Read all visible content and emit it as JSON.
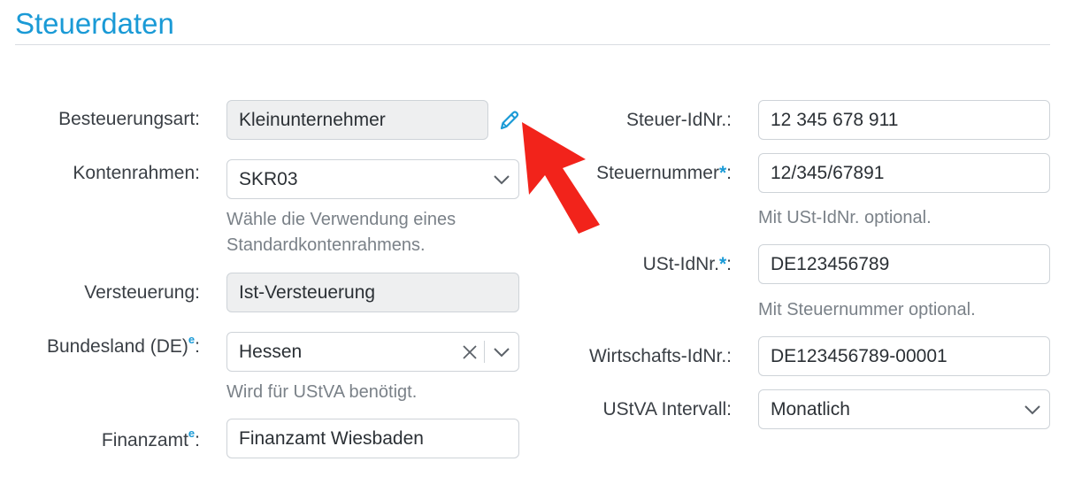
{
  "section": {
    "title": "Steuerdaten"
  },
  "left": {
    "besteuerungsart": {
      "label": "Besteuerungsart:",
      "value": "Kleinunternehmer"
    },
    "kontenrahmen": {
      "label": "Kontenrahmen:",
      "value": "SKR03",
      "hint_line1": "Wähle die Verwendung eines",
      "hint_line2": "Standardkontenrahmens."
    },
    "versteuerung": {
      "label": "Versteuerung:",
      "value": "Ist-Versteuerung"
    },
    "bundesland": {
      "label": "Bundesland (DE)",
      "marker": "e",
      "colon": ":",
      "value": "Hessen",
      "hint": "Wird für UStVA benötigt."
    },
    "finanzamt": {
      "label": "Finanzamt",
      "marker": "e",
      "colon": ":",
      "value": "Finanzamt Wiesbaden"
    }
  },
  "right": {
    "steuer_idnr": {
      "label": "Steuer-IdNr.:",
      "value": "12 345 678 911"
    },
    "steuernummer": {
      "label": "Steuernummer",
      "required": "*",
      "colon": ":",
      "value": "12/345/67891",
      "hint": "Mit USt-IdNr. optional."
    },
    "ust_idnr": {
      "label": "USt-IdNr.",
      "required": "*",
      "colon": ":",
      "value": "DE123456789",
      "hint": "Mit Steuernummer optional."
    },
    "wirtschafts_idnr": {
      "label": "Wirtschafts-IdNr.:",
      "value": "DE123456789-00001"
    },
    "ustva_intervall": {
      "label": "UStVA Intervall:",
      "value": "Monatlich"
    }
  },
  "icons": {
    "edit": "pencil-icon",
    "arrow": "red-arrow-annotation"
  },
  "colors": {
    "accent": "#1a9ad6",
    "arrow": "#f2231b",
    "readonly_bg": "#eeeff0",
    "hint": "#7a8188"
  }
}
